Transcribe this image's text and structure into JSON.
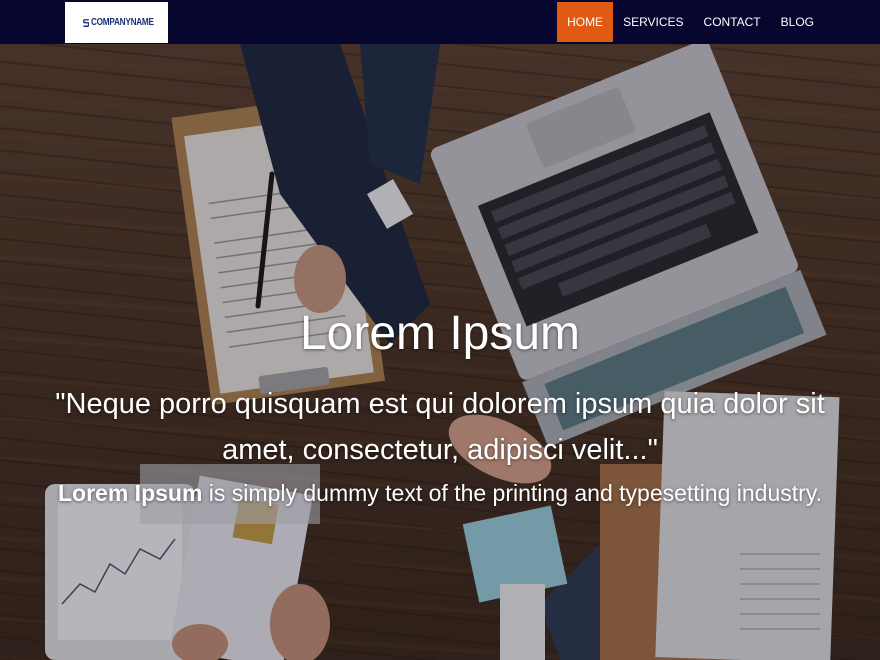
{
  "brand": {
    "logo_icon": "s-logo-icon",
    "name": "COMPANYNAME",
    "color": "#1c2f74"
  },
  "nav": {
    "items": [
      {
        "label": "HOME",
        "active": true
      },
      {
        "label": "SERVICES",
        "active": false
      },
      {
        "label": "CONTACT",
        "active": false
      },
      {
        "label": "BLOG",
        "active": false
      }
    ],
    "active_color": "#e05a14",
    "bar_color": "#07062e"
  },
  "hero": {
    "title": "Lorem Ipsum",
    "quote": "\"Neque porro quisquam est qui dolorem ipsum quia dolor sit amet, consectetur, adipisci velit...\"",
    "desc_bold": "Lorem Ipsum",
    "desc_rest": " is simply dummy text of the printing and typesetting industry.",
    "background_image": "business-handshake-desk-photo"
  }
}
